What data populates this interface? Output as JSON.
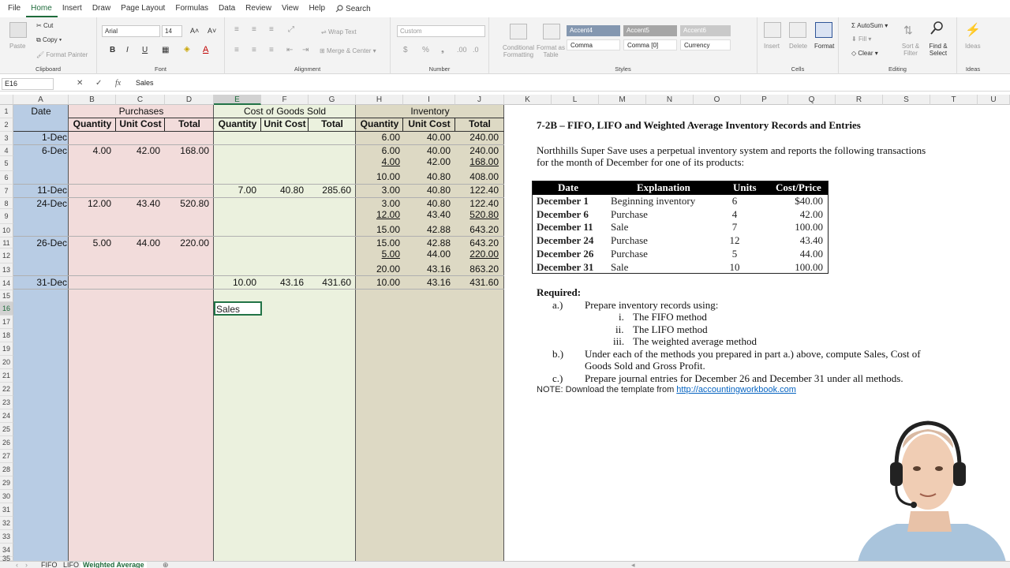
{
  "menu": [
    "File",
    "Home",
    "Insert",
    "Draw",
    "Page Layout",
    "Formulas",
    "Data",
    "Review",
    "View",
    "Help"
  ],
  "menu_active": "Home",
  "search_label": "Search",
  "ribbon": {
    "clipboard": {
      "paste": "Paste",
      "cut": "Cut",
      "copy": "Copy",
      "format_painter": "Format Painter",
      "label": "Clipboard"
    },
    "font": {
      "name": "Arial",
      "size": "14",
      "label": "Font",
      "bold": "B",
      "italic": "I",
      "underline": "U"
    },
    "alignment": {
      "wrap": "Wrap Text",
      "merge": "Merge & Center",
      "label": "Alignment"
    },
    "number": {
      "format": "Custom",
      "label": "Number"
    },
    "styles": {
      "cond": "Conditional Formatting",
      "table": "Format as Table",
      "accent4": "Accent4",
      "accent5": "Accent5",
      "accent6": "Accent6",
      "comma": "Comma",
      "comma0": "Comma [0]",
      "currency": "Currency",
      "label": "Styles"
    },
    "cells": {
      "insert": "Insert",
      "delete": "Delete",
      "format": "Format",
      "label": "Cells"
    },
    "editing": {
      "autosum": "AutoSum",
      "fill": "Fill",
      "clear": "Clear",
      "sort": "Sort & Filter",
      "find": "Find & Select",
      "label": "Editing"
    },
    "ideas": {
      "label": "Ideas",
      "btn": "Ideas"
    }
  },
  "formula_bar": {
    "name_box": "E16",
    "content": "Sales"
  },
  "columns": [
    "A",
    "B",
    "C",
    "D",
    "E",
    "F",
    "G",
    "H",
    "I",
    "J",
    "K",
    "L",
    "M",
    "N",
    "O",
    "P",
    "Q",
    "R",
    "S",
    "T",
    "U"
  ],
  "rows": [
    "1",
    "2",
    "3",
    "4",
    "5",
    "6",
    "7",
    "8",
    "9",
    "10",
    "11",
    "12",
    "13",
    "14",
    "15",
    "16",
    "17",
    "18",
    "19",
    "20",
    "21",
    "22",
    "23",
    "24",
    "25",
    "26",
    "27",
    "28",
    "29",
    "30",
    "31",
    "32",
    "33",
    "34",
    "35"
  ],
  "sheet": {
    "h1": {
      "date": "Date",
      "purchases": "Purchases",
      "cogs": "Cost of Goods Sold",
      "inventory": "Inventory"
    },
    "h2": {
      "qty": "Quantity",
      "unit": "Unit Cost",
      "total": "Total"
    },
    "r3": {
      "date": "1-Dec",
      "iq": "6.00",
      "iu": "40.00",
      "it": "240.00"
    },
    "r4": {
      "date": "6-Dec",
      "pq": "4.00",
      "pu": "42.00",
      "pt": "168.00",
      "iq": "6.00",
      "iu": "40.00",
      "it": "240.00"
    },
    "r5": {
      "iq": "4.00",
      "iu": "42.00",
      "it": "168.00"
    },
    "r6": {
      "iq": "10.00",
      "iu": "40.80",
      "it": "408.00"
    },
    "r7": {
      "date": "11-Dec",
      "cq": "7.00",
      "cu": "40.80",
      "ct": "285.60",
      "iq": "3.00",
      "iu": "40.80",
      "it": "122.40"
    },
    "r8": {
      "date": "24-Dec",
      "pq": "12.00",
      "pu": "43.40",
      "pt": "520.80",
      "iq": "3.00",
      "iu": "40.80",
      "it": "122.40"
    },
    "r9": {
      "iq": "12.00",
      "iu": "43.40",
      "it": "520.80"
    },
    "r10": {
      "iq": "15.00",
      "iu": "42.88",
      "it": "643.20"
    },
    "r11": {
      "date": "26-Dec",
      "pq": "5.00",
      "pu": "44.00",
      "pt": "220.00",
      "iq": "15.00",
      "iu": "42.88",
      "it": "643.20"
    },
    "r12": {
      "iq": "5.00",
      "iu": "44.00",
      "it": "220.00"
    },
    "r13": {
      "iq": "20.00",
      "iu": "43.16",
      "it": "863.20"
    },
    "r14": {
      "date": "31-Dec",
      "cq": "10.00",
      "cu": "43.16",
      "ct": "431.60",
      "iq": "10.00",
      "iu": "43.16",
      "it": "431.60"
    },
    "r16": {
      "e": "Sales"
    }
  },
  "problem": {
    "title": "7-2B – FIFO, LIFO and Weighted Average Inventory Records and Entries",
    "intro1": "Northhills Super Save uses a perpetual inventory system and reports the following transactions",
    "intro2": "for the month of December for one of its products:",
    "table_head": [
      "Date",
      "Explanation",
      "Units",
      "Cost/Price"
    ],
    "table_rows": [
      [
        "December 1",
        "Beginning inventory",
        "6",
        "$40.00"
      ],
      [
        "December 6",
        "Purchase",
        "4",
        "42.00"
      ],
      [
        "December 11",
        "Sale",
        "7",
        "100.00"
      ],
      [
        "December 24",
        "Purchase",
        "12",
        "43.40"
      ],
      [
        "December 26",
        "Purchase",
        "5",
        "44.00"
      ],
      [
        "December 31",
        "Sale",
        "10",
        "100.00"
      ]
    ],
    "required": "Required:",
    "a_label": "a.)",
    "a_text": "Prepare inventory records using:",
    "i": "i.",
    "i_text": "The FIFO method",
    "ii": "ii.",
    "ii_text": "The LIFO method",
    "iii": "iii.",
    "iii_text": "The weighted average method",
    "b_label": "b.)",
    "b_text1": "Under each of the methods you prepared in part a.) above, compute Sales, Cost of",
    "b_text2": "Goods Sold and Gross Profit.",
    "c_label": "c.)",
    "c_text": "Prepare journal entries for December 26 and December 31 under all methods.",
    "note": "NOTE:  Download the template from ",
    "link": "http://accountingworkbook.com"
  },
  "tabs": [
    "FIFO",
    "LIFO",
    "Weighted Average"
  ],
  "active_tab": "Weighted Average",
  "colors": {
    "date_band": "#b8cce4",
    "purchases_band": "#f2dcdb",
    "cogs_band": "#ebf1de",
    "inventory_band": "#ddd9c4",
    "accent": "#217346"
  }
}
